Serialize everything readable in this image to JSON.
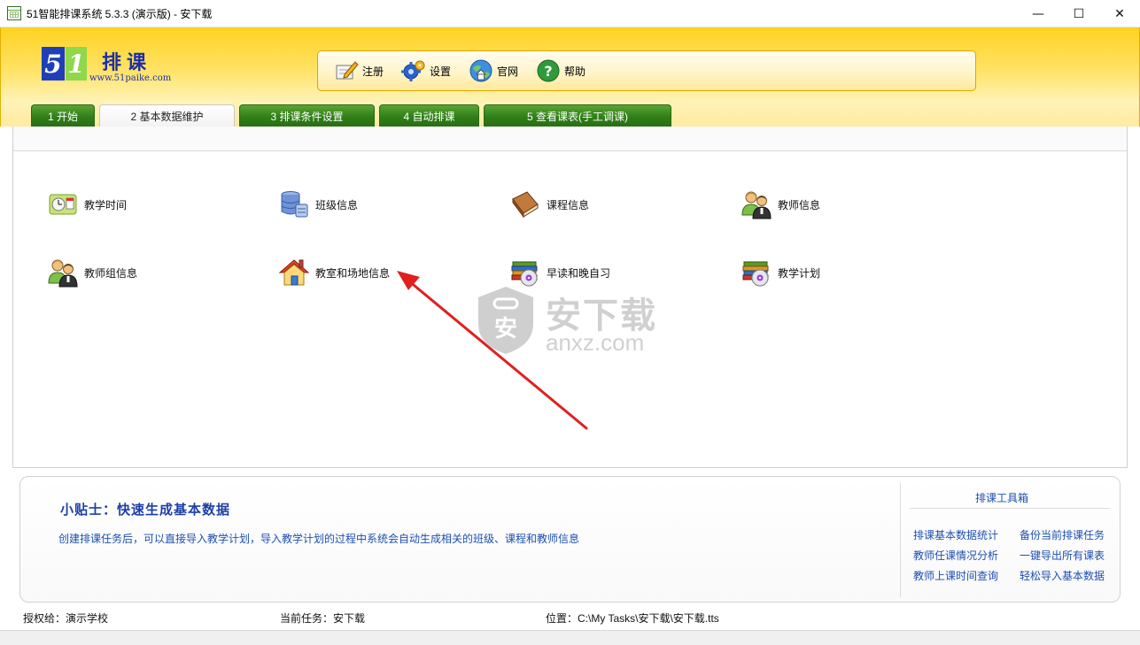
{
  "window": {
    "title": "51智能排课系统 5.3.3 (演示版) - 安下载",
    "minimize": "—",
    "maximize": "☐",
    "close": "✕"
  },
  "logo": {
    "digit5": "5",
    "digit1": "1",
    "brand": "排课",
    "url": "www.51paike.com"
  },
  "toolbar": {
    "register_label": "注册",
    "settings_label": "设置",
    "website_label": "官网",
    "help_label": "帮助"
  },
  "tabs": [
    {
      "label": "1 开始"
    },
    {
      "label": "2 基本数据维护"
    },
    {
      "label": "3 排课条件设置"
    },
    {
      "label": "4 自动排课"
    },
    {
      "label": "5 查看课表(手工调课)"
    }
  ],
  "functions": {
    "teaching_time": "教学时间",
    "class_info": "班级信息",
    "course_info": "课程信息",
    "teacher_info": "教师信息",
    "teacher_group_info": "教师组信息",
    "classroom_info": "教室和场地信息",
    "morning_evening": "早读和晚自习",
    "teaching_plan": "教学计划"
  },
  "watermark": {
    "cn": "安下载",
    "en": "anxz.com",
    "shield_char": "安"
  },
  "tips": {
    "title": "小贴士：快速生成基本数据",
    "body": "创建排课任务后，可以直接导入教学计划，导入教学计划的过程中系统会自动生成相关的班级、课程和教师信息"
  },
  "toolbox": {
    "title": "排课工具箱",
    "links": [
      "排课基本数据统计",
      "备份当前排课任务",
      "教师任课情况分析",
      "一键导出所有课表",
      "教师上课时间查询",
      "轻松导入基本数据"
    ]
  },
  "status": {
    "licensed": "授权给：演示学校",
    "current_task": "当前任务：安下载",
    "location": "位置：C:\\My Tasks\\安下载\\安下载.tts"
  },
  "colors": {
    "header_yellow": "#ffd21f",
    "tab_green": "#2f7f18",
    "link_blue": "#1d4fb0",
    "arrow_red": "#e02020"
  }
}
